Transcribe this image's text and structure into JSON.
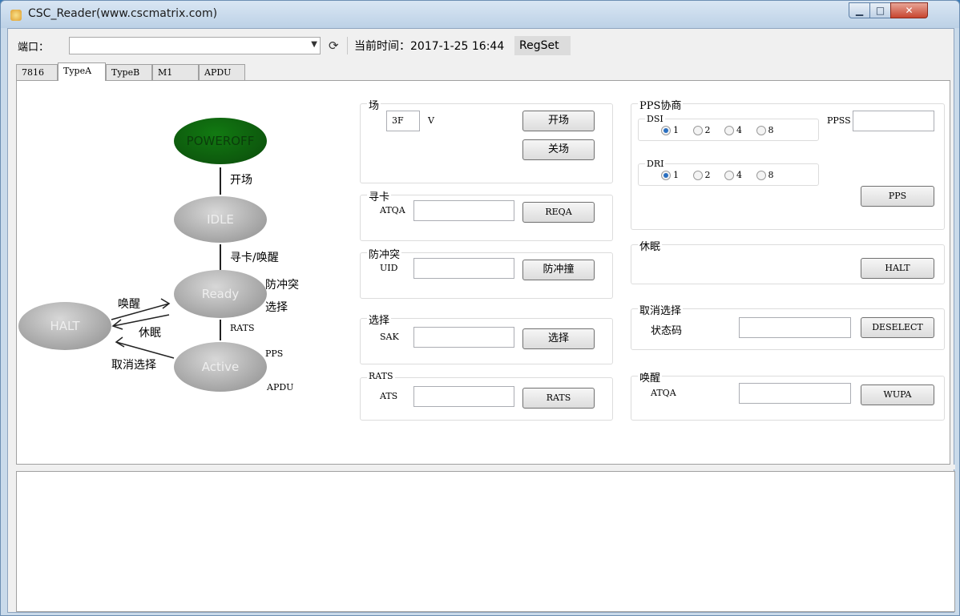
{
  "window": {
    "title": "CSC_Reader(www.cscmatrix.com)",
    "controls": {
      "minimize": "▁",
      "maximize": "□",
      "close": "✕"
    }
  },
  "toolbar": {
    "port_label": "端口：",
    "port_value": "",
    "time_label": "当前时间：2017-1-25 16:44",
    "regset_label": "RegSet"
  },
  "tabs": [
    {
      "label": "7816"
    },
    {
      "label": "TypeA"
    },
    {
      "label": "TypeB"
    },
    {
      "label": "M1"
    },
    {
      "label": "APDU"
    }
  ],
  "diagram": {
    "states": {
      "poweroff": "POWEROFF",
      "idle": "IDLE",
      "ready": "Ready",
      "active": "Active",
      "halt": "HALT"
    },
    "transitions": {
      "open_field": "开场",
      "search_wake": "寻卡/唤醒",
      "anticollision": "防冲突",
      "select": "选择",
      "rats": "RATS",
      "wake": "唤醒",
      "sleep": "休眠",
      "deselect": "取消选择",
      "pps": "PPS",
      "apdu": "APDU"
    }
  },
  "field_group": {
    "title": "场",
    "value": "3F",
    "unit": "V",
    "open_button": "开场",
    "close_button": "关场"
  },
  "search_group": {
    "title": "寻卡",
    "field_label": "ATQA",
    "field_value": "",
    "button": "REQA"
  },
  "anticollision_group": {
    "title": "防冲突",
    "field_label": "UID",
    "field_value": "",
    "button": "防冲撞"
  },
  "select_group": {
    "title": "选择",
    "field_label": "SAK",
    "field_value": "",
    "button": "选择"
  },
  "rats_group": {
    "title": "RATS",
    "field_label": "ATS",
    "field_value": "",
    "button": "RATS"
  },
  "pps_group": {
    "title": "PPS协商",
    "dsi_label": "DSI",
    "dri_label": "DRI",
    "options": [
      "1",
      "2",
      "4",
      "8"
    ],
    "dsi_selected": "1",
    "dri_selected": "1",
    "ppss_label": "PPSS",
    "ppss_value": "",
    "button": "PPS"
  },
  "sleep_group": {
    "title": "休眠",
    "button": "HALT"
  },
  "deselect_group": {
    "title": "取消选择",
    "field_label": "状态码",
    "field_value": "",
    "button": "DESELECT"
  },
  "wake_group": {
    "title": "唤醒",
    "field_label": "ATQA",
    "field_value": "",
    "button": "WUPA"
  },
  "log": {
    "content": ""
  }
}
